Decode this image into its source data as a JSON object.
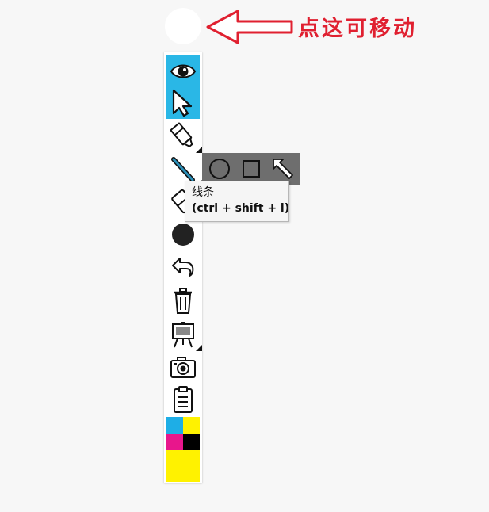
{
  "annotation": {
    "text": "点这可移动",
    "color": "#e02030"
  },
  "toolbar": {
    "active_color": "#2ab7e6",
    "tools": [
      {
        "name": "view",
        "icon": "eye-icon",
        "active": true
      },
      {
        "name": "select",
        "icon": "cursor-arrow-icon",
        "active": true
      },
      {
        "name": "marker",
        "icon": "marker-icon",
        "active": false,
        "has_submenu": true
      },
      {
        "name": "line",
        "icon": "line-icon",
        "active": false,
        "has_submenu": true
      },
      {
        "name": "eraser",
        "icon": "eraser-icon",
        "active": false
      },
      {
        "name": "color",
        "icon": "color-circle-icon",
        "active": false,
        "current_color": "#222222"
      },
      {
        "name": "undo",
        "icon": "undo-icon",
        "active": false
      },
      {
        "name": "clear",
        "icon": "trash-icon",
        "active": false
      },
      {
        "name": "background",
        "icon": "easel-icon",
        "active": false,
        "has_submenu": true
      },
      {
        "name": "screenshot",
        "icon": "camera-icon",
        "active": false
      },
      {
        "name": "clipboard",
        "icon": "clipboard-icon",
        "active": false
      }
    ],
    "palette": [
      "#1eaee6",
      "#fff200",
      "#e8168c",
      "#000000",
      "#fff200"
    ]
  },
  "shape_submenu": {
    "background": "#6e6e6e",
    "items": [
      {
        "name": "circle",
        "icon": "circle-shape-icon"
      },
      {
        "name": "rectangle",
        "icon": "square-shape-icon"
      },
      {
        "name": "arrow",
        "icon": "arrow-shape-icon"
      }
    ]
  },
  "tooltip": {
    "title": "线条",
    "shortcut": "(ctrl + shift + l)"
  }
}
